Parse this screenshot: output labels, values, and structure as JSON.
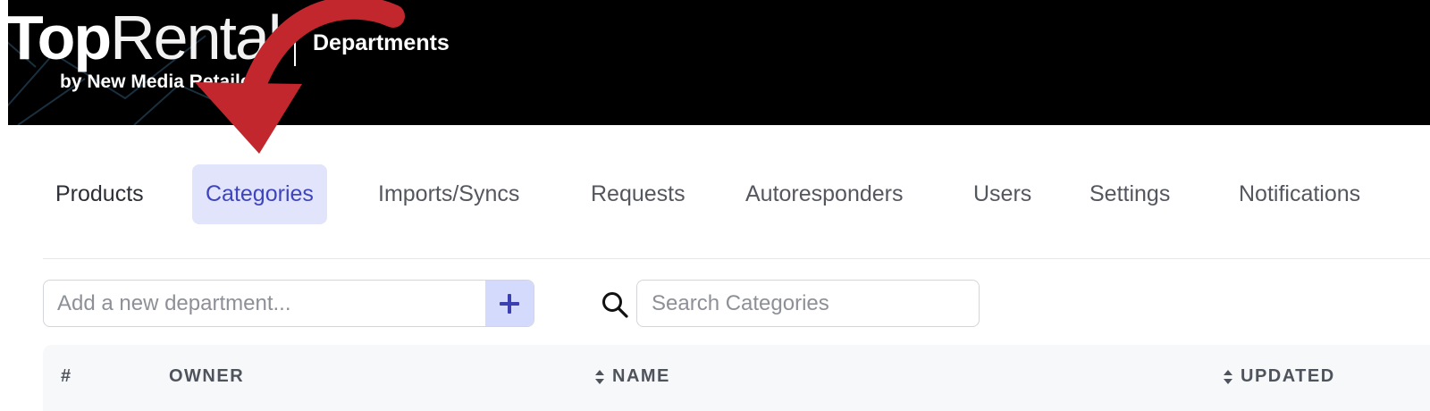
{
  "header": {
    "logo": {
      "top": "Top",
      "rental": "Rental",
      "byline": "by New Media Retailer"
    },
    "title": "Departments"
  },
  "tabs": [
    {
      "label": "Products",
      "active": false
    },
    {
      "label": "Categories",
      "active": true
    },
    {
      "label": "Imports/Syncs",
      "active": false
    },
    {
      "label": "Requests",
      "active": false
    },
    {
      "label": "Autoresponders",
      "active": false
    },
    {
      "label": "Users",
      "active": false
    },
    {
      "label": "Settings",
      "active": false
    },
    {
      "label": "Notifications",
      "active": false
    }
  ],
  "add_department": {
    "placeholder": "Add a new department...",
    "button_icon": "plus-icon"
  },
  "search": {
    "icon": "search-icon",
    "placeholder": "Search Categories"
  },
  "table": {
    "columns": [
      {
        "label": "#",
        "sortable": false
      },
      {
        "label": "OWNER",
        "sortable": false
      },
      {
        "label": "NAME",
        "sortable": true
      },
      {
        "label": "UPDATED",
        "sortable": true
      }
    ]
  },
  "annotation": {
    "icon": "red-arrow-icon",
    "color": "#c1272d"
  },
  "colors": {
    "header_bg": "#000000",
    "active_tab_bg": "#e1e4fb",
    "active_tab_text": "#3e44bd",
    "add_button_bg": "#d4dafb",
    "plus_color": "#3b3fb2"
  }
}
